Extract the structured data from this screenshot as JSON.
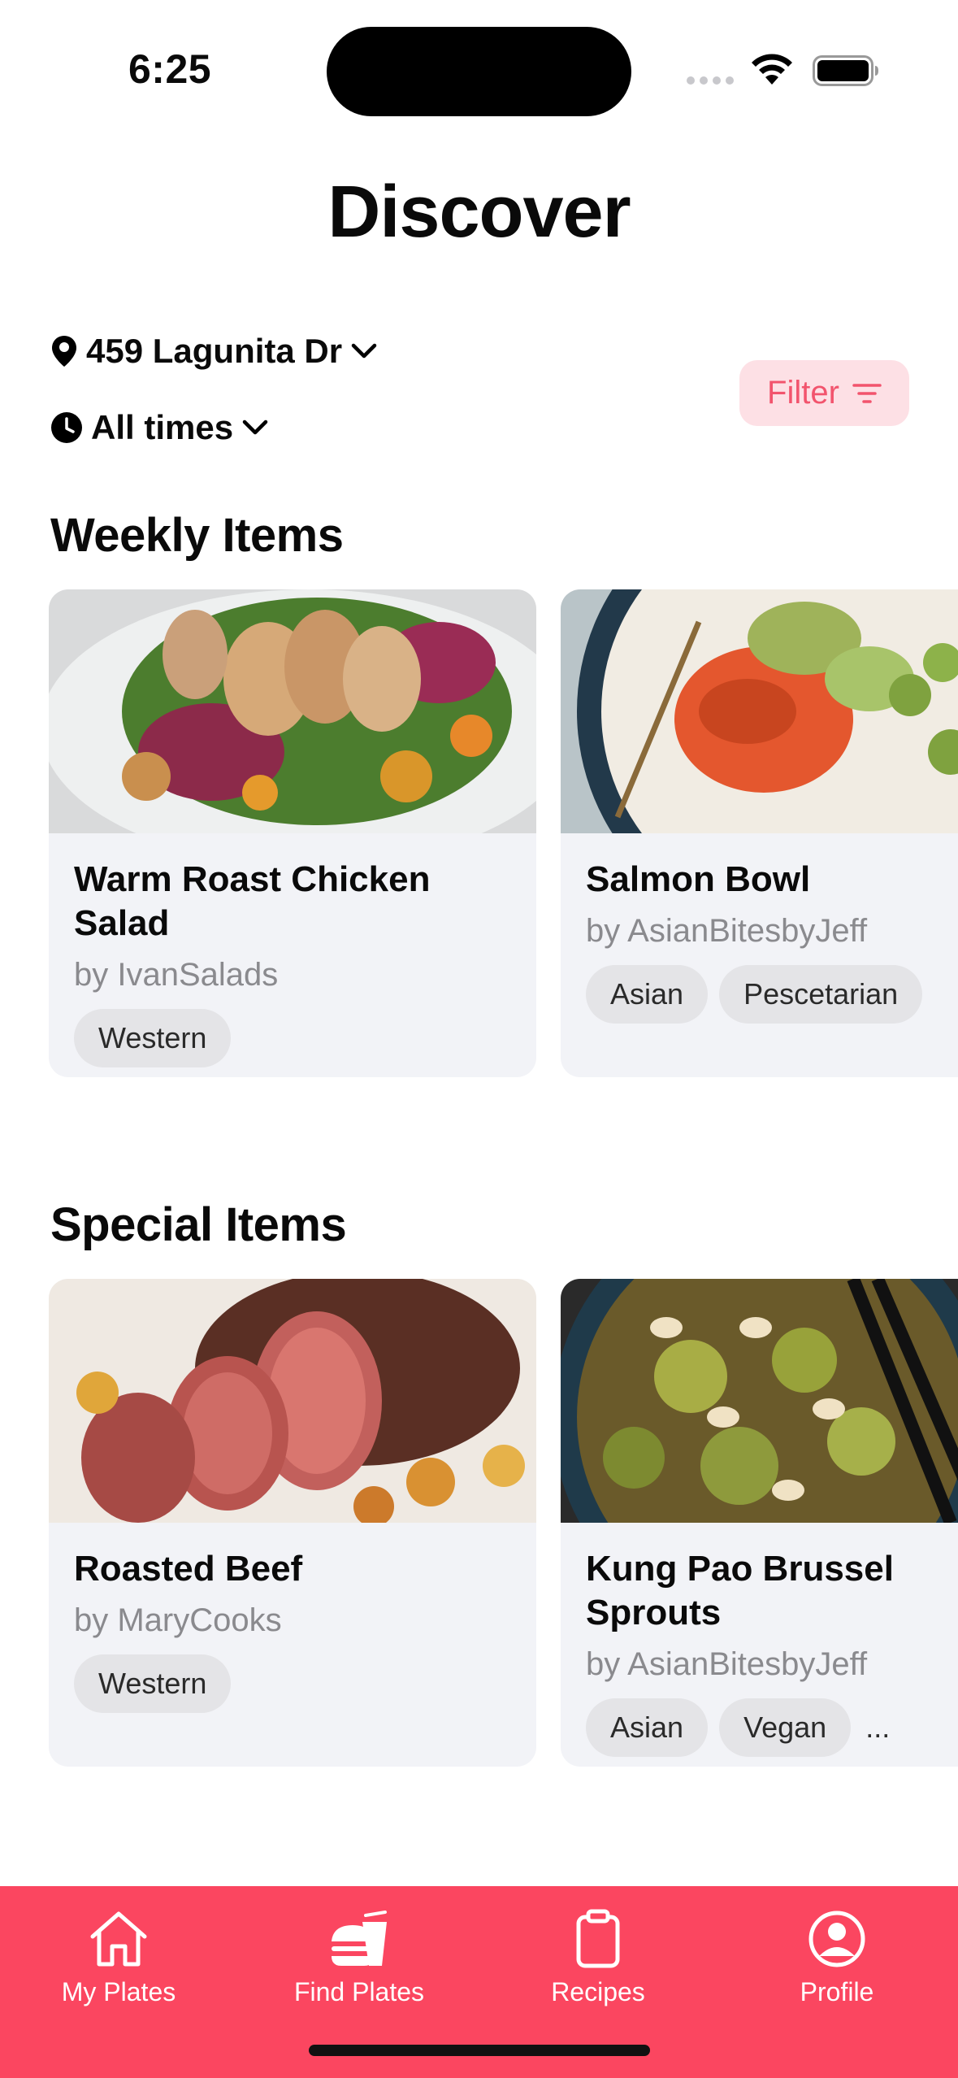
{
  "status_bar": {
    "time": "6:25"
  },
  "header": {
    "title": "Discover"
  },
  "filters": {
    "location": "459 Lagunita Dr",
    "time": "All times",
    "filter_label": "Filter"
  },
  "sections": [
    {
      "title": "Weekly Items",
      "cards": [
        {
          "title": "Warm Roast Chicken Salad",
          "author": "by IvanSalads",
          "tags": [
            "Western"
          ]
        },
        {
          "title": "Salmon Bowl",
          "author": "by AsianBitesbyJeff",
          "tags": [
            "Asian",
            "Pescetarian"
          ]
        }
      ]
    },
    {
      "title": "Special Items",
      "cards": [
        {
          "title": "Roasted Beef",
          "author": "by MaryCooks",
          "tags": [
            "Western"
          ]
        },
        {
          "title": "Kung Pao Brussel Sprouts",
          "author": "by AsianBitesbyJeff",
          "tags": [
            "Asian",
            "Vegan"
          ],
          "more": "..."
        }
      ]
    }
  ],
  "tab_bar": {
    "items": [
      {
        "label": "My Plates",
        "icon": "home-icon"
      },
      {
        "label": "Find Plates",
        "icon": "burger-drink-icon"
      },
      {
        "label": "Recipes",
        "icon": "clipboard-icon"
      },
      {
        "label": "Profile",
        "icon": "profile-icon"
      }
    ]
  },
  "colors": {
    "accent": "#fb4660",
    "filter_bg": "#fde0e5",
    "filter_text": "#f2546d",
    "card_bg": "#f2f3f7"
  }
}
